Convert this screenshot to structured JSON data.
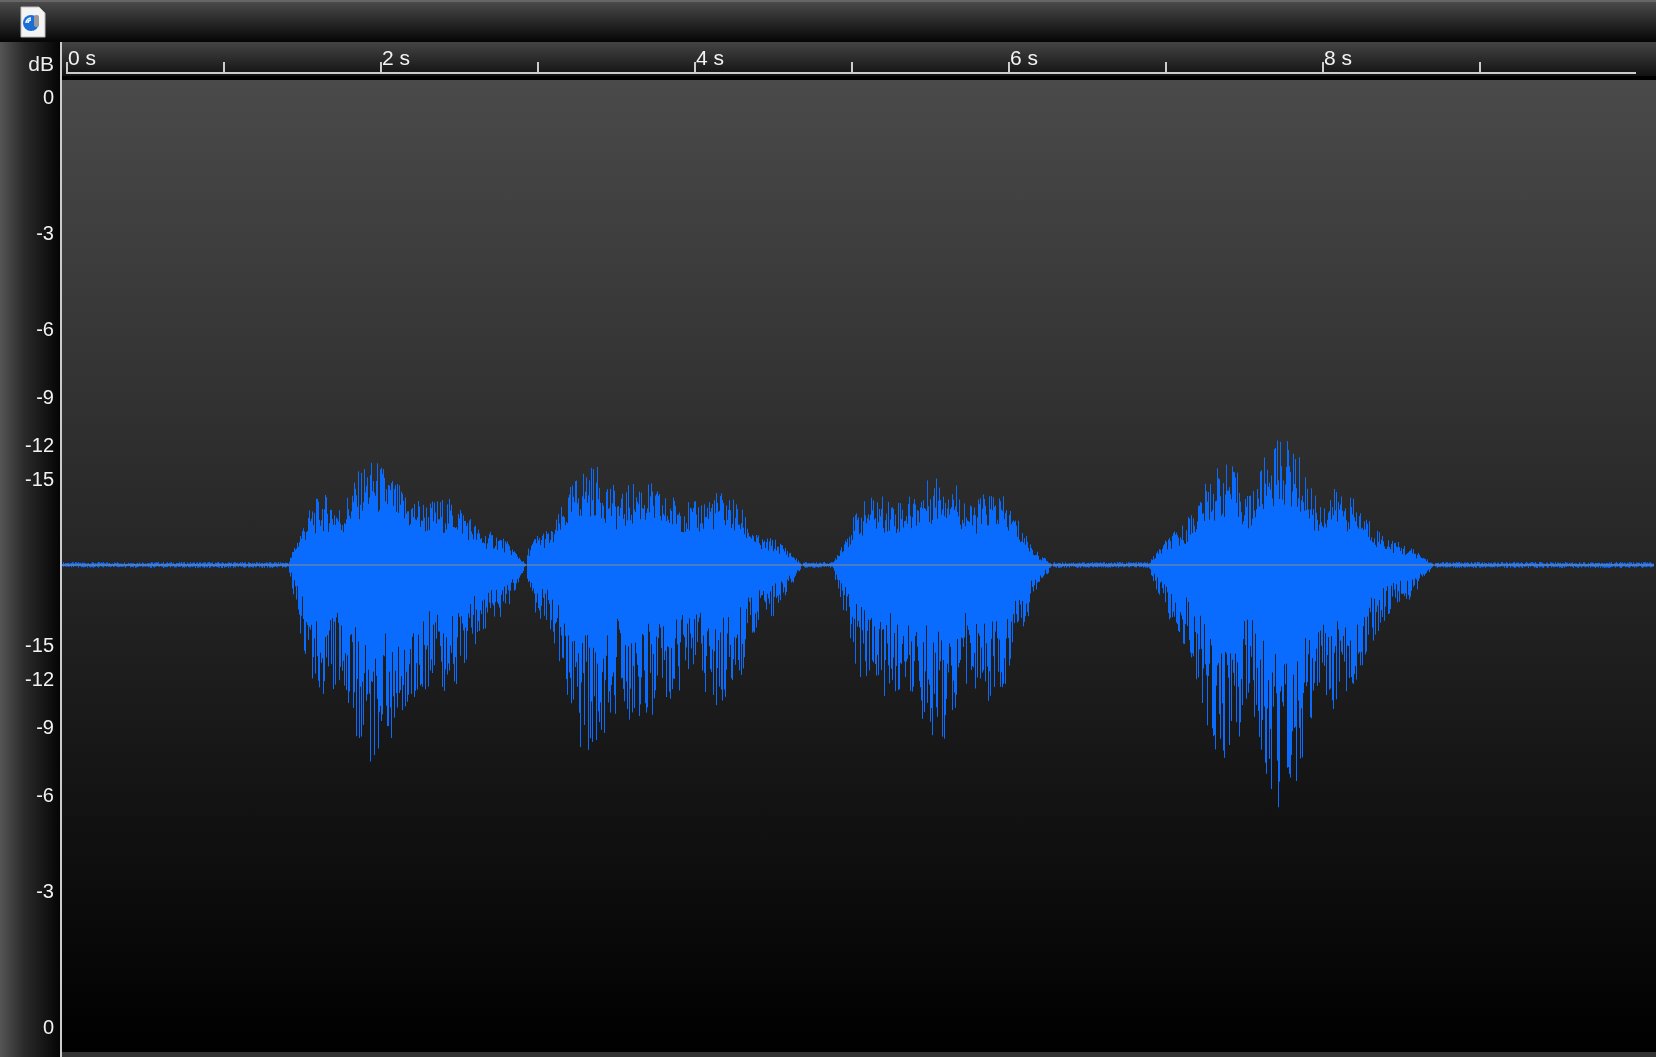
{
  "db_unit": "dB",
  "time_labels": [
    "0 s",
    "2 s",
    "4 s",
    "6 s",
    "8 s"
  ],
  "db_upper": [
    "0",
    "-3",
    "-6",
    "-9",
    "-12",
    "-15"
  ],
  "db_lower": [
    "-15",
    "-12",
    "-9",
    "-6",
    "-3",
    "0"
  ]
}
